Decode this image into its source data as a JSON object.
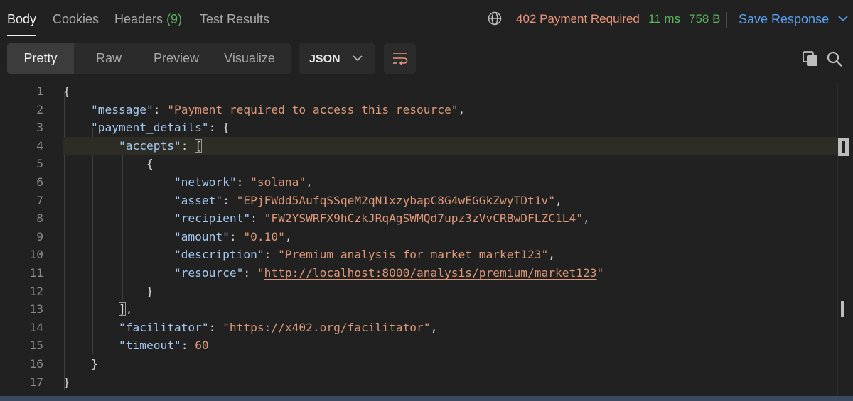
{
  "tabs": [
    {
      "label": "Body",
      "count": ""
    },
    {
      "label": "Headers",
      "count": "(9)"
    },
    {
      "label": "Cookies",
      "count": ""
    },
    {
      "label": "Test Results",
      "count": ""
    }
  ],
  "status": {
    "code": "402 Payment Required",
    "time": "11 ms",
    "size": "758 B"
  },
  "save_response": "Save Response",
  "views": {
    "pretty": "Pretty",
    "raw": "Raw",
    "preview": "Preview",
    "visualize": "Visualize"
  },
  "format": "JSON",
  "icons": {
    "globe": "globe-icon",
    "chevron": "chevron-down-icon",
    "wrap": "wrap-lines-icon",
    "copy": "copy-icon",
    "search": "search-icon"
  },
  "colors": {
    "status_error": "#e8957a",
    "status_ok": "#58b55c",
    "accent": "#5a9ff0",
    "json_key": "#a5c8f0",
    "json_string": "#dc9878"
  },
  "code_lines": [
    {
      "n": "1",
      "tokens": [
        [
          "p",
          "{"
        ]
      ]
    },
    {
      "n": "2",
      "tokens": [
        [
          "p",
          "    "
        ],
        [
          "k",
          "\"message\""
        ],
        [
          "p",
          ": "
        ],
        [
          "s",
          "\"Payment required to access this resource\""
        ],
        [
          "p",
          ","
        ]
      ]
    },
    {
      "n": "3",
      "tokens": [
        [
          "p",
          "    "
        ],
        [
          "k",
          "\"payment_details\""
        ],
        [
          "p",
          ": {"
        ]
      ]
    },
    {
      "n": "4",
      "tokens": [
        [
          "p",
          "        "
        ],
        [
          "k",
          "\"accepts\""
        ],
        [
          "p",
          ": "
        ],
        [
          "bm",
          "["
        ]
      ]
    },
    {
      "n": "5",
      "tokens": [
        [
          "p",
          "            {"
        ]
      ]
    },
    {
      "n": "6",
      "tokens": [
        [
          "p",
          "                "
        ],
        [
          "k",
          "\"network\""
        ],
        [
          "p",
          ": "
        ],
        [
          "s",
          "\"solana\""
        ],
        [
          "p",
          ","
        ]
      ]
    },
    {
      "n": "7",
      "tokens": [
        [
          "p",
          "                "
        ],
        [
          "k",
          "\"asset\""
        ],
        [
          "p",
          ": "
        ],
        [
          "s",
          "\"EPjFWdd5AufqSSqeM2qN1xzybapC8G4wEGGkZwyTDt1v\""
        ],
        [
          "p",
          ","
        ]
      ]
    },
    {
      "n": "8",
      "tokens": [
        [
          "p",
          "                "
        ],
        [
          "k",
          "\"recipient\""
        ],
        [
          "p",
          ": "
        ],
        [
          "s",
          "\"FW2YSWRFX9hCzkJRqAgSWMQd7upz3zVvCRBwDFLZC1L4\""
        ],
        [
          "p",
          ","
        ]
      ]
    },
    {
      "n": "9",
      "tokens": [
        [
          "p",
          "                "
        ],
        [
          "k",
          "\"amount\""
        ],
        [
          "p",
          ": "
        ],
        [
          "s",
          "\"0.10\""
        ],
        [
          "p",
          ","
        ]
      ]
    },
    {
      "n": "10",
      "tokens": [
        [
          "p",
          "                "
        ],
        [
          "k",
          "\"description\""
        ],
        [
          "p",
          ": "
        ],
        [
          "s",
          "\"Premium analysis for market market123\""
        ],
        [
          "p",
          ","
        ]
      ]
    },
    {
      "n": "11",
      "tokens": [
        [
          "p",
          "                "
        ],
        [
          "k",
          "\"resource\""
        ],
        [
          "p",
          ": "
        ],
        [
          "s",
          "\""
        ],
        [
          "u",
          "http://localhost:8000/analysis/premium/market123"
        ],
        [
          "s",
          "\""
        ]
      ]
    },
    {
      "n": "12",
      "tokens": [
        [
          "p",
          "            }"
        ]
      ]
    },
    {
      "n": "13",
      "tokens": [
        [
          "p",
          "        "
        ],
        [
          "bm",
          "]"
        ],
        [
          "p",
          ","
        ]
      ]
    },
    {
      "n": "14",
      "tokens": [
        [
          "p",
          "        "
        ],
        [
          "k",
          "\"facilitator\""
        ],
        [
          "p",
          ": "
        ],
        [
          "s",
          "\""
        ],
        [
          "u",
          "https://x402.org/facilitator"
        ],
        [
          "s",
          "\""
        ],
        [
          "p",
          ","
        ]
      ]
    },
    {
      "n": "15",
      "tokens": [
        [
          "p",
          "        "
        ],
        [
          "k",
          "\"timeout\""
        ],
        [
          "p",
          ": "
        ],
        [
          "n",
          "60"
        ]
      ]
    },
    {
      "n": "16",
      "tokens": [
        [
          "p",
          "    }"
        ]
      ]
    },
    {
      "n": "17",
      "tokens": [
        [
          "p",
          "}"
        ]
      ]
    }
  ]
}
